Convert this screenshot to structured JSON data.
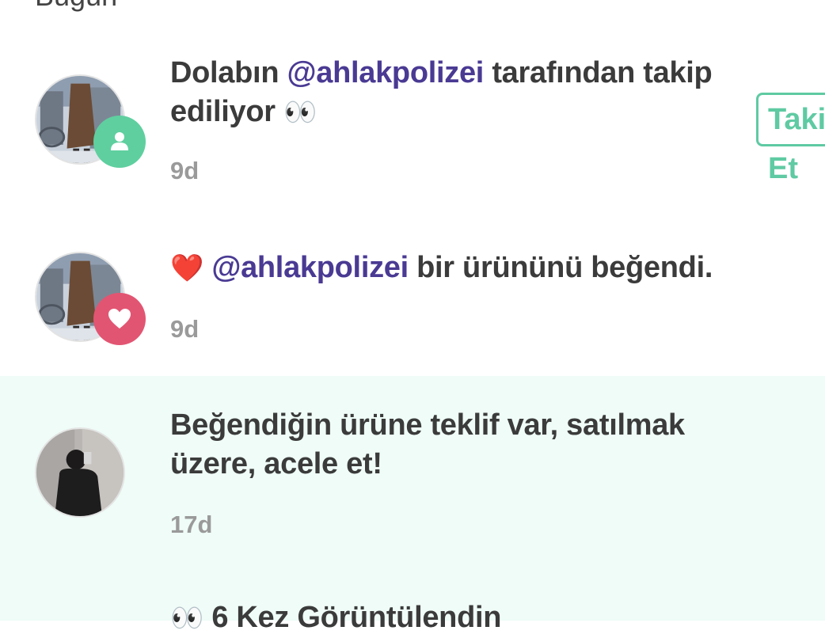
{
  "section": {
    "header": "Bugün"
  },
  "notifications": [
    {
      "prefix": "Dolabın ",
      "mention": "@ahlakpolizei",
      "suffix": " tarafından takip ediliyor",
      "emoji": "👀",
      "time": "9d",
      "badge": "user-icon",
      "badge_color": "#5fcf9f",
      "action_label": "Takip Et"
    },
    {
      "emoji": "❤️",
      "mention": "@ahlakpolizei",
      "suffix": " bir ürününü beğendi.",
      "time": "9d",
      "badge": "heart-icon",
      "badge_color": "#e25572"
    },
    {
      "text": "Beğendiğin ürüne teklif var, satılmak üzere, acele et!",
      "time": "17d",
      "highlighted": true
    },
    {
      "emoji": "👀",
      "text": "6 Kez Görüntülendin"
    }
  ],
  "colors": {
    "accent": "#5fcaa3",
    "mention": "#4a3a93",
    "highlight_bg": "#effcf7",
    "time": "#9a9a9a"
  }
}
